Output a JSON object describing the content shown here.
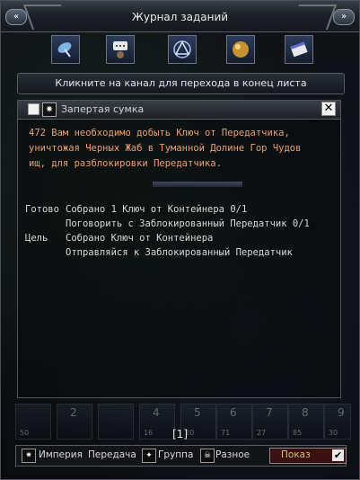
{
  "window": {
    "title": "Журнал заданий",
    "corner_icon": "double-chevron-icon"
  },
  "toolbar": {
    "icons": [
      "satellite-dish-icon",
      "chat-avatar-icon",
      "sigil-icon",
      "orb-icon",
      "book-icon"
    ]
  },
  "channel_hint": "Кликните на канал для перехода в конец листа",
  "quest": {
    "name": "Запертая сумка",
    "desc_lines": [
      "472  Вам необходимо добыть Ключ от Передатчика,",
      "уничтожая Черных Жаб в Туманной Долине Гор Чудов",
      "ищ, для разблокировки Передатчика."
    ],
    "progress": [
      {
        "label": "Готово",
        "value": "Собрано 1 Ключ от Контейнера  0/1"
      },
      {
        "label": "",
        "value": "Поговорить с Заблокированный Передатчик  0/1"
      },
      {
        "label": "Цель",
        "value": "Собрано Ключ от Контейнера"
      },
      {
        "label": "",
        "value": "Отправляйся к Заблокированный Передатчик"
      }
    ]
  },
  "hotbar": {
    "slots": [
      {
        "num": "",
        "sub": "50"
      },
      {
        "num": "2",
        "sub": ""
      },
      {
        "num": "",
        "sub": ""
      },
      {
        "num": "4",
        "sub": "16"
      },
      {
        "num": "5",
        "sub": "20"
      },
      {
        "num": "6",
        "sub": "71"
      },
      {
        "num": "7",
        "sub": "27"
      },
      {
        "num": "8",
        "sub": "85"
      },
      {
        "num": "9",
        "sub": "30"
      }
    ],
    "page": "[1]"
  },
  "bottom": {
    "filters": [
      {
        "icon": "star-icon",
        "label": "Империя"
      },
      {
        "icon": "",
        "label": "Передача"
      },
      {
        "icon": "sigil-icon",
        "label": "Группа"
      },
      {
        "icon": "skull-icon",
        "label": "Разное"
      }
    ],
    "dropdown_value": "Показ"
  }
}
